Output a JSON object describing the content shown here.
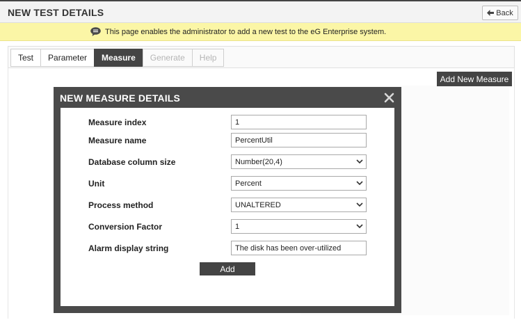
{
  "header": {
    "title": "NEW TEST DETAILS",
    "back_label": "Back"
  },
  "info": {
    "text": "This page enables the administrator to add a new test to the eG Enterprise system."
  },
  "tabs": [
    {
      "label": "Test",
      "state": "normal"
    },
    {
      "label": "Parameter",
      "state": "normal"
    },
    {
      "label": "Measure",
      "state": "active"
    },
    {
      "label": "Generate",
      "state": "disabled"
    },
    {
      "label": "Help",
      "state": "disabled"
    }
  ],
  "toolbar": {
    "add_new_measure_label": "Add New Measure"
  },
  "modal": {
    "title": "NEW MEASURE DETAILS",
    "fields": {
      "measure_index": {
        "label": "Measure index",
        "value": "1"
      },
      "measure_name": {
        "label": "Measure name",
        "value": "PercentUtil"
      },
      "db_column_size": {
        "label": "Database column size",
        "value": "Number(20,4)"
      },
      "unit": {
        "label": "Unit",
        "value": "Percent"
      },
      "process_method": {
        "label": "Process method",
        "value": "UNALTERED"
      },
      "conversion_factor": {
        "label": "Conversion Factor",
        "value": "1"
      },
      "alarm_display": {
        "label": "Alarm display string",
        "value": "The disk has been over-utilized"
      }
    },
    "add_label": "Add"
  },
  "colors": {
    "header_bg": "#f3f3f3",
    "info_bg": "#fbf6a6",
    "dark": "#444444",
    "modal_frame": "#4a4a4a"
  }
}
